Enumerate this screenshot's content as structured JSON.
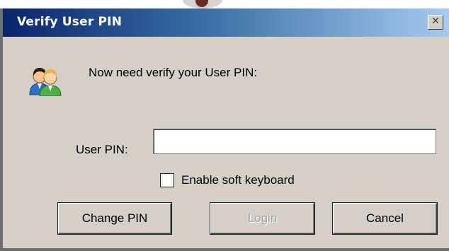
{
  "window": {
    "title": "Verify User PIN",
    "close_symbol": "✕",
    "icon": "users-icon"
  },
  "message": "Now need verify your User PIN:",
  "pin_field": {
    "label": "User PIN:",
    "value": "",
    "placeholder": ""
  },
  "soft_keyboard": {
    "label": "Enable soft keyboard",
    "checked": false
  },
  "buttons": {
    "change_pin": "Change PIN",
    "login": "Login",
    "login_enabled": false,
    "cancel": "Cancel"
  },
  "colors": {
    "titlebar_start": "#0a246a",
    "titlebar_end": "#a6caf0",
    "dialog_bg": "#d4d0c8"
  }
}
